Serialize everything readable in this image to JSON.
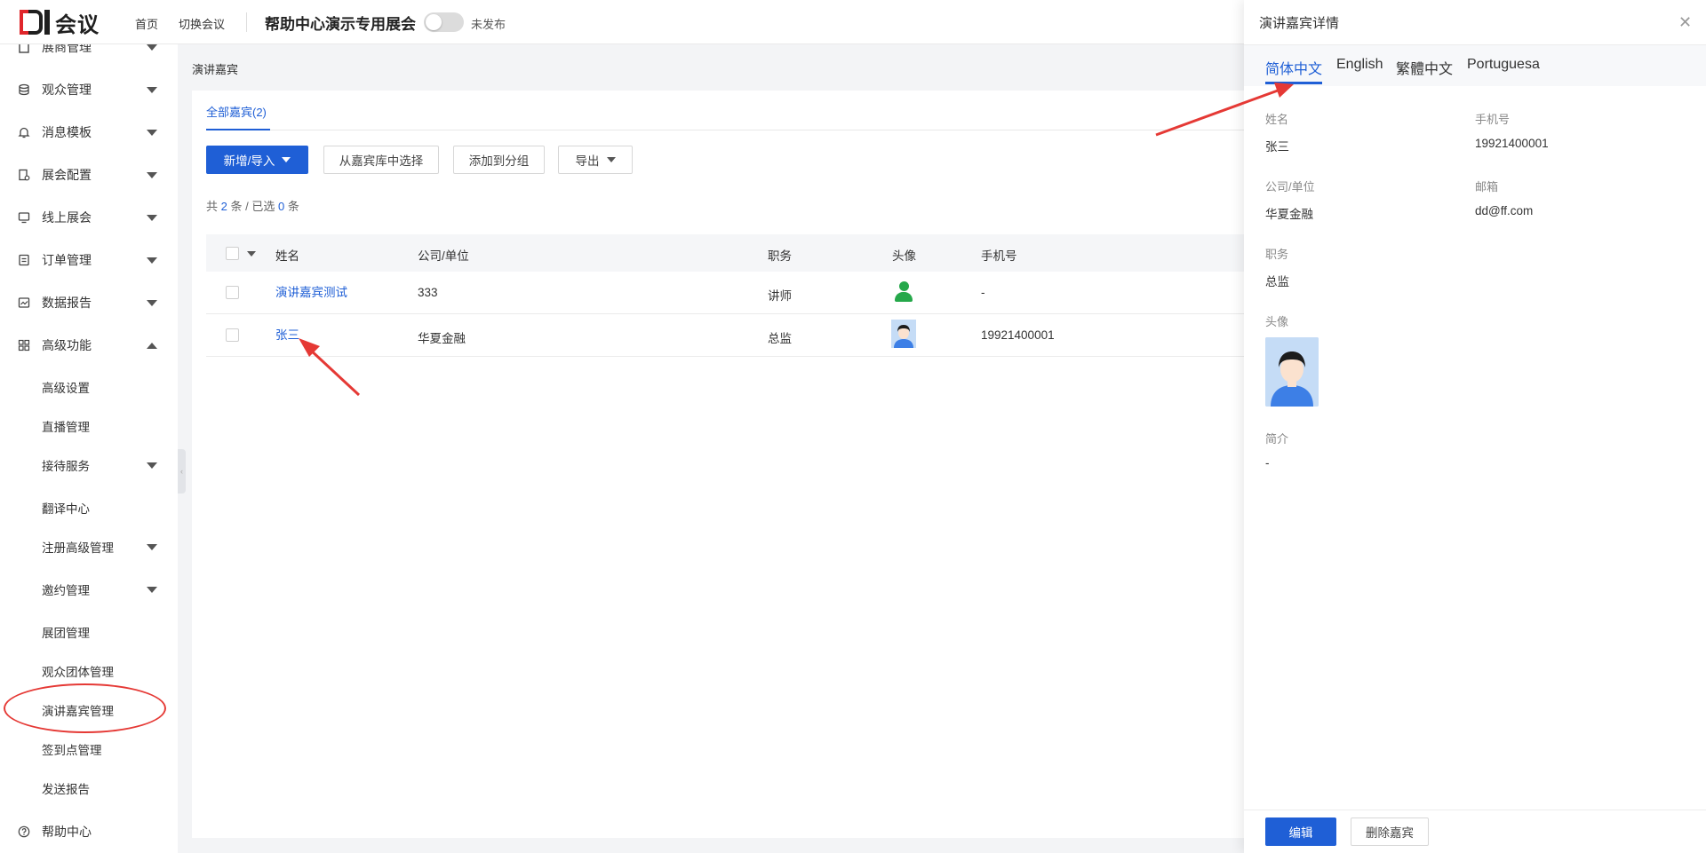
{
  "header": {
    "logo_text": "会议",
    "nav": [
      "首页",
      "切换会议"
    ],
    "event_title": "帮助中心演示专用展会",
    "publish_status": "未发布"
  },
  "sidebar": {
    "items": [
      {
        "label": "展商管理",
        "icon": "building-icon"
      },
      {
        "label": "观众管理",
        "icon": "database-icon"
      },
      {
        "label": "消息模板",
        "icon": "bell-icon"
      },
      {
        "label": "展会配置",
        "icon": "settings-doc-icon"
      },
      {
        "label": "线上展会",
        "icon": "monitor-icon"
      },
      {
        "label": "订单管理",
        "icon": "list-doc-icon"
      },
      {
        "label": "数据报告",
        "icon": "chart-icon"
      },
      {
        "label": "高级功能",
        "icon": "grid-icon"
      }
    ],
    "sub_items": [
      "高级设置",
      "直播管理",
      "接待服务",
      "翻译中心",
      "注册高级管理",
      "邀约管理",
      "展团管理",
      "观众团体管理",
      "演讲嘉宾管理",
      "签到点管理",
      "发送报告"
    ],
    "help": "帮助中心"
  },
  "main": {
    "breadcrumb": "演讲嘉宾",
    "tab": "全部嘉宾(2)",
    "buttons": {
      "add_import": "新增/导入",
      "select_library": "从嘉宾库中选择",
      "add_group": "添加到分组",
      "export": "导出"
    },
    "count": {
      "prefix": "共",
      "total": "2",
      "mid": "条 / 已选",
      "selected": "0",
      "suffix": "条"
    },
    "table": {
      "columns": [
        "姓名",
        "公司/单位",
        "职务",
        "头像",
        "手机号"
      ],
      "rows": [
        {
          "name": "演讲嘉宾测试",
          "company": "333",
          "title": "讲师",
          "phone": "-"
        },
        {
          "name": "张三",
          "company": "华夏金融",
          "title": "总监",
          "phone": "19921400001"
        }
      ]
    }
  },
  "drawer": {
    "title": "演讲嘉宾详情",
    "languages": [
      "简体中文",
      "English",
      "繁體中文",
      "Portuguesa"
    ],
    "fields": {
      "name_label": "姓名",
      "name": "张三",
      "phone_label": "手机号",
      "phone": "19921400001",
      "company_label": "公司/单位",
      "company": "华夏金融",
      "email_label": "邮箱",
      "email": "dd@ff.com",
      "position_label": "职务",
      "position": "总监",
      "avatar_label": "头像",
      "bio_label": "简介",
      "bio": "-"
    },
    "buttons": {
      "edit": "编辑",
      "delete": "删除嘉宾"
    }
  },
  "colors": {
    "accent": "#1f5fd6",
    "annotation": "#e53935",
    "brand_red": "#e0262b"
  }
}
